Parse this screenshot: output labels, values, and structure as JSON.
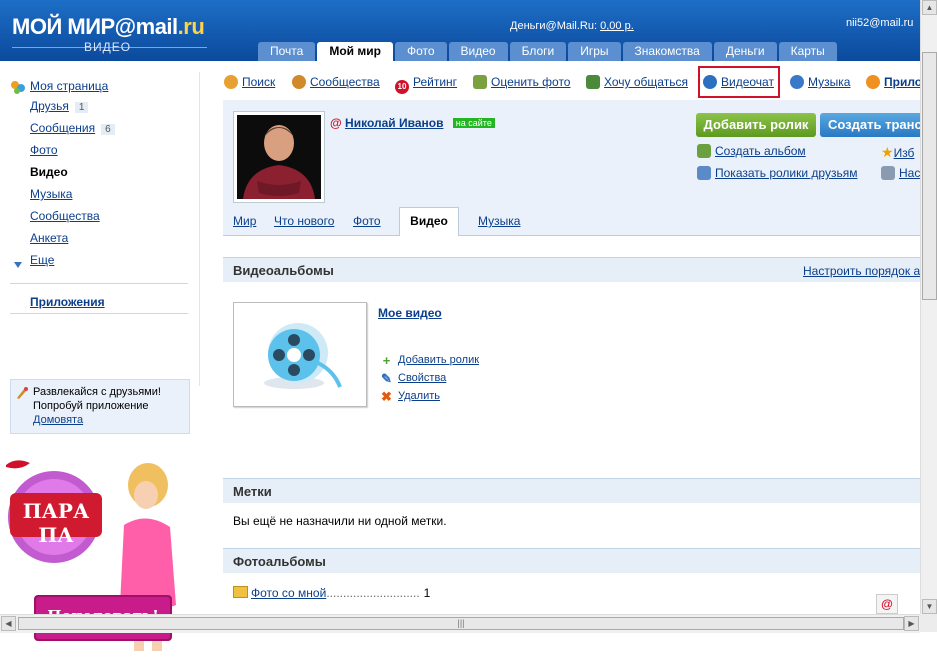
{
  "header": {
    "logo": "МОЙ МИР@mail",
    "logo_ru": ".ru",
    "logo_sub": "ВИДЕО",
    "money_label": "Деньги@Mail.Ru:",
    "money_value": "0,00 р.",
    "user_email": "nii52@mail.ru",
    "tabs": [
      {
        "label": "Почта"
      },
      {
        "label": "Мой мир"
      },
      {
        "label": "Фото"
      },
      {
        "label": "Видео"
      },
      {
        "label": "Блоги"
      },
      {
        "label": "Игры"
      },
      {
        "label": "Знакомства"
      },
      {
        "label": "Деньги"
      },
      {
        "label": "Карты"
      }
    ]
  },
  "sidebar": {
    "my_page": "Моя страница",
    "items": [
      {
        "label": "Друзья",
        "count": "1"
      },
      {
        "label": "Сообщения",
        "count": "6"
      },
      {
        "label": "Фото"
      },
      {
        "label": "Видео"
      },
      {
        "label": "Музыка"
      },
      {
        "label": "Сообщества"
      },
      {
        "label": "Анкета"
      },
      {
        "label": "Еще"
      }
    ],
    "apps_label": "Приложения",
    "promo_line1": "Развлекайся с друзьями!",
    "promo_line2": "Попробуй приложение",
    "promo_link": "Домовята",
    "ad_title": "ПАРА ПА",
    "ad_button": "Поцеловать!"
  },
  "toolbar": {
    "items": [
      {
        "label": "Поиск"
      },
      {
        "label": "Сообщества"
      },
      {
        "label": "Рейтинг"
      },
      {
        "label": "Оценить фото"
      },
      {
        "label": "Хочу общаться"
      },
      {
        "label": "Видеочат"
      },
      {
        "label": "Музыка"
      },
      {
        "label": "Прило"
      }
    ],
    "rating_badge": "10"
  },
  "profile": {
    "name": "Николай Иванов",
    "status": "на сайте",
    "add_video_button": "Добавить ролик",
    "create_broadcast_button": "Создать трансл",
    "create_album_link": "Создать альбом",
    "show_friends_videos_link": "Показать ролики друзьям",
    "side_link_1": "Изб",
    "side_link_2": "Нас",
    "tabs": [
      {
        "label": "Мир"
      },
      {
        "label": "Что нового"
      },
      {
        "label": "Фото"
      },
      {
        "label": "Видео"
      },
      {
        "label": "Музыка"
      }
    ]
  },
  "video_albums": {
    "title": "Видеоальбомы",
    "sort_link": "Настроить порядок а",
    "album_name": "Мое видео",
    "actions": [
      {
        "label": "Добавить ролик"
      },
      {
        "label": "Свойства"
      },
      {
        "label": "Удалить"
      }
    ]
  },
  "tags": {
    "title": "Метки",
    "empty_text": "Вы ещё не назначили ни одной метки."
  },
  "photo_albums": {
    "title": "Фотоальбомы",
    "album_name": "Фото со мной",
    "album_dots": "............................",
    "album_count": "1"
  },
  "colors": {
    "header_blue": "#0b4a9c",
    "link_blue": "#0b3f8c",
    "highlight_red": "#d0112b",
    "online_green": "#22b722"
  }
}
